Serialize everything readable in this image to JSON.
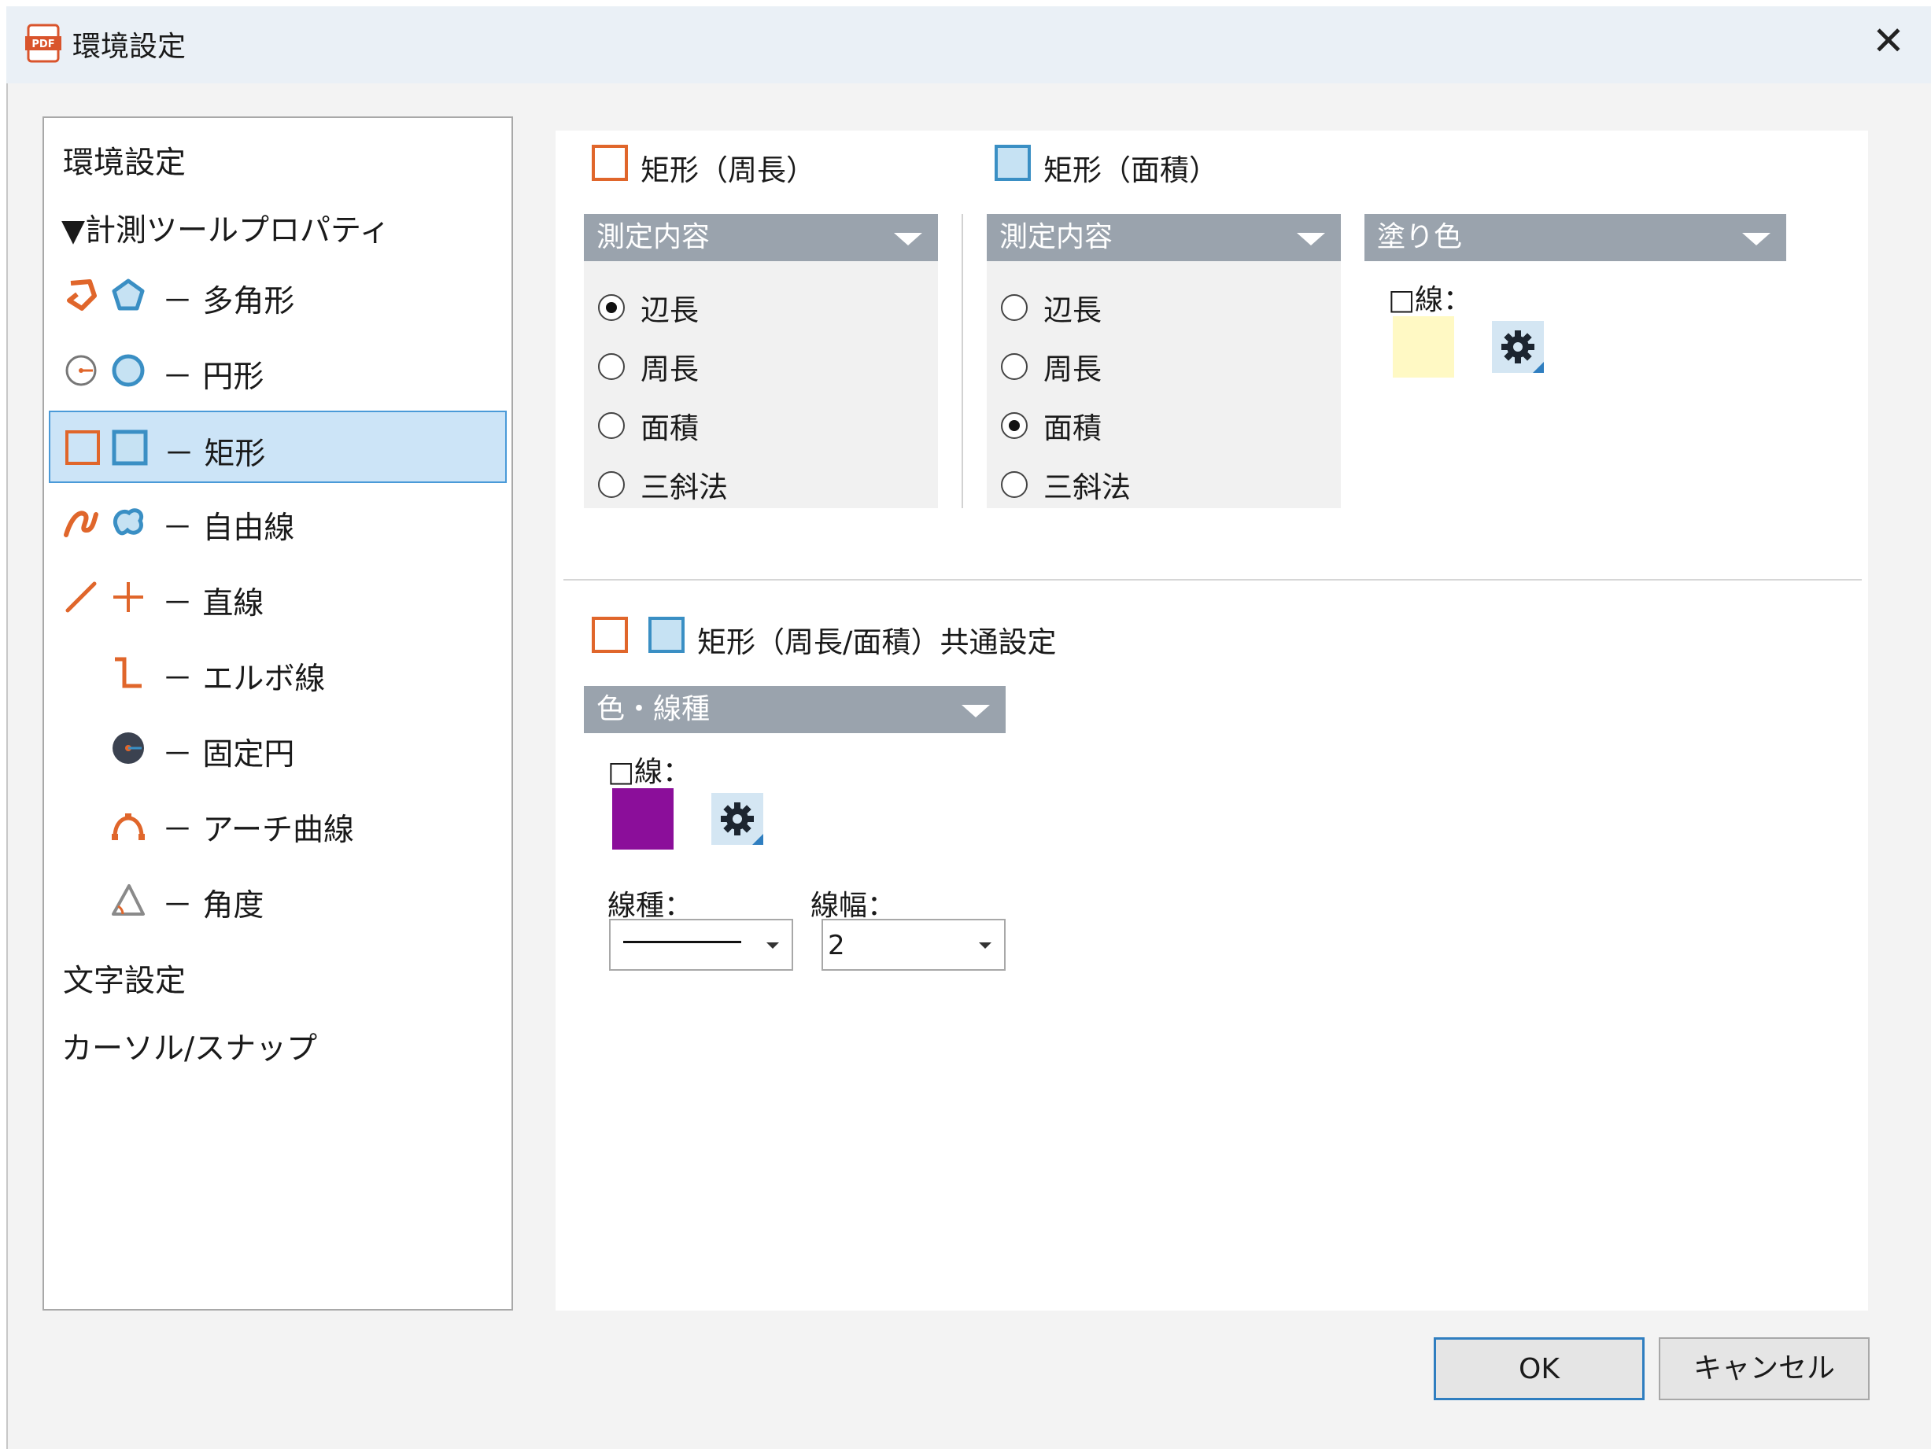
{
  "window": {
    "title": "環境設定",
    "close_glyph": "✕"
  },
  "sidebar": {
    "top_items": [
      {
        "label": "環境設定"
      },
      {
        "label": "▼計測ツールプロパティ"
      }
    ],
    "tool_items": [
      {
        "label": "－ 多角形",
        "icons": [
          "polygon-open-icon",
          "polygon-filled-icon"
        ]
      },
      {
        "label": "－ 円形",
        "icons": [
          "circle-radius-icon",
          "circle-icon"
        ]
      },
      {
        "label": "－ 矩形",
        "icons": [
          "rectangle-outline-icon",
          "rectangle-filled-icon"
        ],
        "selected": true
      },
      {
        "label": "－ 自由線",
        "icons": [
          "freehand-open-icon",
          "freehand-closed-icon"
        ]
      },
      {
        "label": "－ 直線",
        "icons": [
          "line-icon",
          "cross-line-icon"
        ]
      },
      {
        "label": "－ エルボ線",
        "icons": [
          "elbow-line-icon"
        ]
      },
      {
        "label": "－ 固定円",
        "icons": [
          "fixed-circle-icon"
        ]
      },
      {
        "label": "－ アーチ曲線",
        "icons": [
          "arch-curve-icon"
        ]
      },
      {
        "label": "－ 角度",
        "icons": [
          "angle-icon"
        ]
      }
    ],
    "bottom_items": [
      {
        "label": "文字設定"
      },
      {
        "label": "カーソル/スナップ"
      }
    ]
  },
  "perimeter": {
    "header": "矩形（周長）",
    "group_title": "測定内容",
    "options": [
      "辺長",
      "周長",
      "面積",
      "三斜法"
    ],
    "selected": "辺長"
  },
  "area": {
    "header": "矩形（面積）",
    "group_title": "測定内容",
    "options": [
      "辺長",
      "周長",
      "面積",
      "三斜法"
    ],
    "selected": "面積",
    "fill_group_title": "塗り色",
    "fill_line_label": "□線：",
    "fill_color": "#fff9c4"
  },
  "common": {
    "header": "矩形（周長/面積）共通設定",
    "group_title": "色・線種",
    "line_label": "□線：",
    "line_color": "#8b0e9a",
    "line_type_label": "線種：",
    "line_width_label": "線幅：",
    "line_width_value": "2"
  },
  "buttons": {
    "ok": "OK",
    "cancel": "キャンセル"
  },
  "colors": {
    "accent_blue": "#2f7ec0",
    "orange": "#e0662b",
    "group_header": "#9aa3ad",
    "selected_row": "#cce4f7"
  }
}
